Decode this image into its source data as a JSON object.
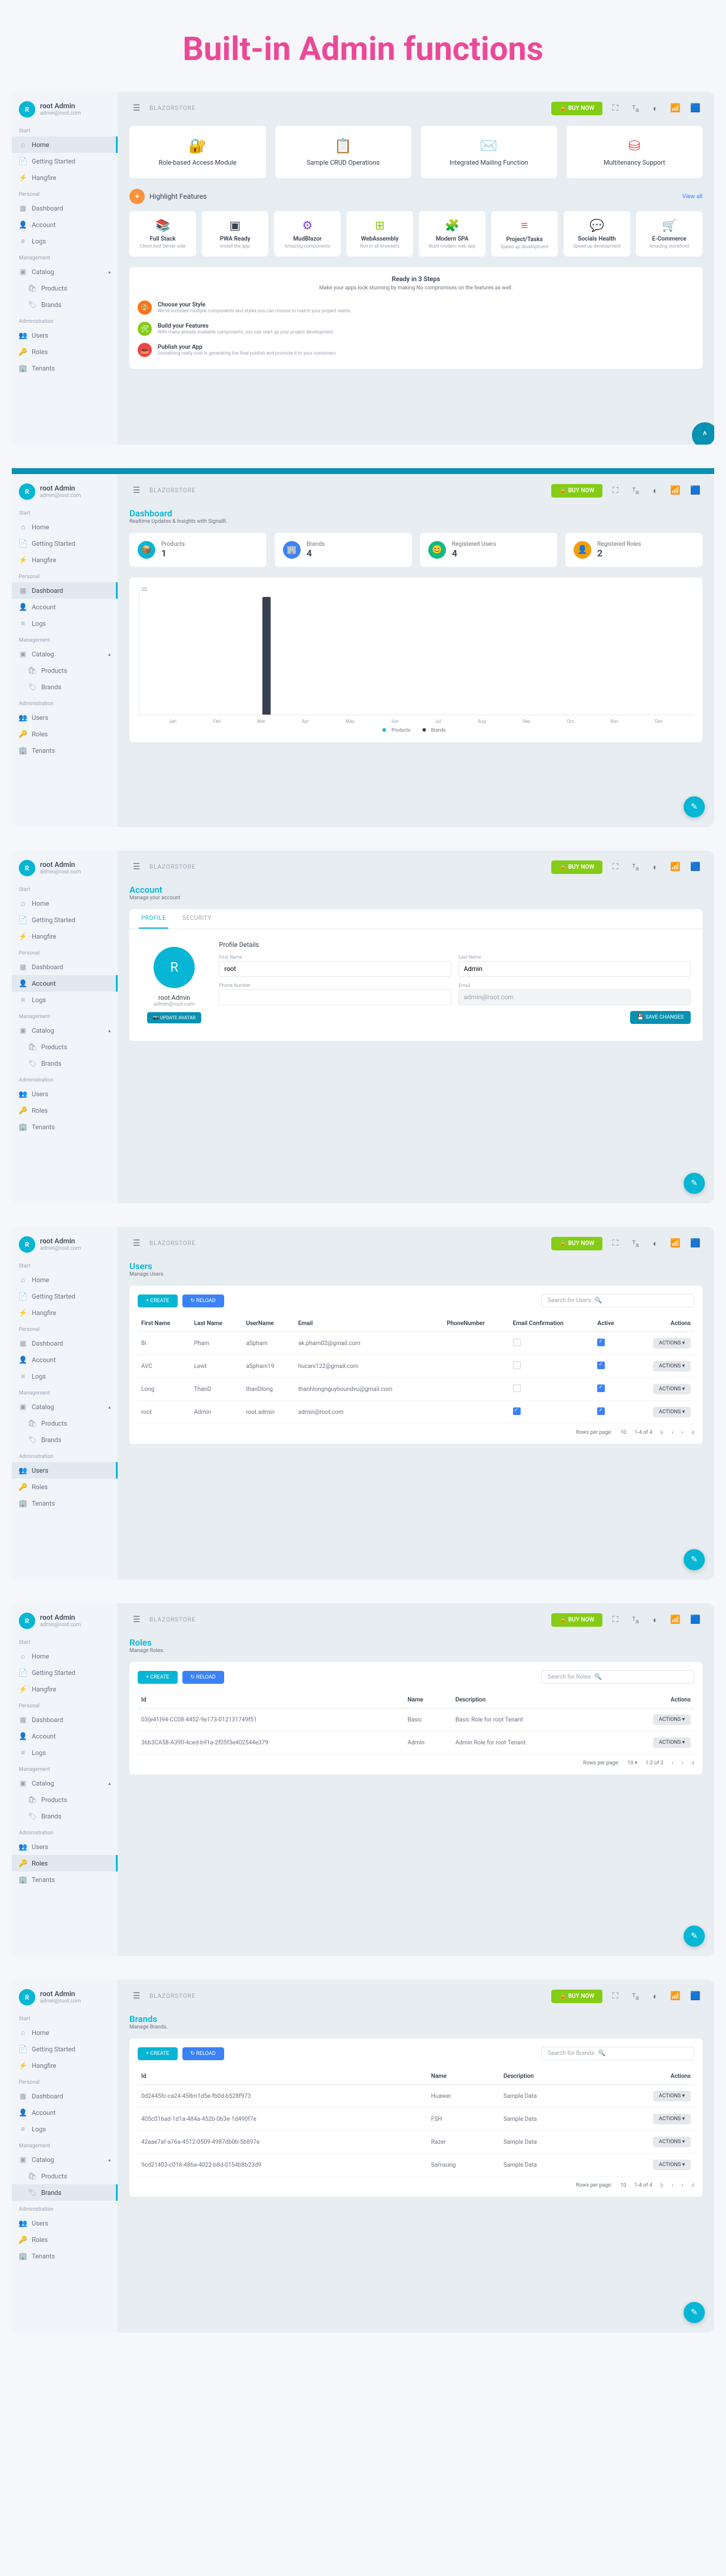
{
  "title": "Built-in Admin functions",
  "user": {
    "initial": "R",
    "name": "root Admin",
    "email": "admin@root.com"
  },
  "nav": {
    "s_start": "Start",
    "home": "Home",
    "getting": "Getting Started",
    "hangfire": "Hangfire",
    "s_personal": "Personal",
    "dashboard": "Dashboard",
    "account": "Account",
    "logs": "Logs",
    "s_mgmt": "Management",
    "catalog": "Catalog",
    "products": "Products",
    "brands": "Brands",
    "s_admin": "Administration",
    "users": "Users",
    "roles": "Roles",
    "tenants": "Tenants"
  },
  "topbar": {
    "brand": "BLAZORSTORE",
    "buy": "BUY NOW"
  },
  "s1": {
    "feats": [
      {
        "icon": "🔐",
        "lbl": "Role-based Access Module",
        "c": "#f97316"
      },
      {
        "icon": "📋",
        "lbl": "Sample CRUD Operations",
        "c": "#ef4444"
      },
      {
        "icon": "✉️",
        "lbl": "Integrated Mailing Function",
        "c": "#f97316"
      },
      {
        "icon": "⛁",
        "lbl": "Multitenancy Support",
        "c": "#ef4444"
      }
    ],
    "hl_title": "Highlight Features",
    "hl_view": "View all",
    "hl": [
      {
        "ico": "📚",
        "name": "Full Stack",
        "desc": "Client And Server side",
        "c": "#d97706"
      },
      {
        "ico": "▣",
        "name": "PWA Ready",
        "desc": "Install the app",
        "c": "#374151"
      },
      {
        "ico": "⚙",
        "name": "MudBlazor",
        "desc": "Amazing components",
        "c": "#7c3aed"
      },
      {
        "ico": "⊞",
        "name": "WebAssembly",
        "desc": "Run in all browsers",
        "c": "#84cc16"
      },
      {
        "ico": "🧩",
        "name": "Modern SPA",
        "desc": "Build modern web app",
        "c": "#06b6d4"
      },
      {
        "ico": "≡",
        "name": "Project/Tasks",
        "desc": "Speed up development",
        "c": "#ef4444"
      },
      {
        "ico": "💬",
        "name": "Socials Health",
        "desc": "Speed up development",
        "c": "#0891b2"
      },
      {
        "ico": "🛒",
        "name": "E-Commerce",
        "desc": "Amazing storefront",
        "c": "#f59e0b"
      }
    ],
    "steps_title": "Ready in 3 Steps",
    "steps_sub": "Make your apps look stunning by making No compromises on the features as well.",
    "steps": [
      {
        "c": "#f97316",
        "ico": "🎨",
        "t": "Choose your Style",
        "d": "We've included multiple components and styles you can choose to match your project needs."
      },
      {
        "c": "#84cc16",
        "ico": "🛠",
        "t": "Build your Features",
        "d": "With many already available components, you can start up your project development."
      },
      {
        "c": "#ef4444",
        "ico": "📤",
        "t": "Publish your App",
        "d": "Something really cool is generating the final publish and promote it to your customers."
      }
    ]
  },
  "s2": {
    "title": "Dashboard",
    "sub": "Realtime Updates & Insights with SignalR.",
    "stats": [
      {
        "c": "#06b6d4",
        "ico": "📦",
        "lbl": "Products",
        "val": "1"
      },
      {
        "c": "#3b82f6",
        "ico": "🏢",
        "lbl": "Brands",
        "val": "4"
      },
      {
        "c": "#10b981",
        "ico": "😊",
        "lbl": "Registered Users",
        "val": "4"
      },
      {
        "c": "#f59e0b",
        "ico": "👤",
        "lbl": "Registered Roles",
        "val": "2"
      }
    ],
    "months": [
      "Jan",
      "Feb",
      "Mar",
      "Apr",
      "May",
      "Jun",
      "Jul",
      "Aug",
      "Sep",
      "Oct",
      "Nov",
      "Dec"
    ],
    "legend": {
      "p": "Products",
      "b": "Brands"
    }
  },
  "chart_data": {
    "type": "bar",
    "categories": [
      "Jan",
      "Feb",
      "Mar",
      "Apr",
      "May",
      "Jun",
      "Jul",
      "Aug",
      "Sep",
      "Oct",
      "Nov",
      "Dec"
    ],
    "series": [
      {
        "name": "Products",
        "values": [
          0,
          0,
          0,
          0,
          0,
          0,
          0,
          0,
          0,
          0,
          0,
          0
        ]
      },
      {
        "name": "Brands",
        "values": [
          0,
          0,
          20,
          0,
          0,
          0,
          0,
          0,
          0,
          0,
          0,
          0
        ]
      }
    ],
    "ylim": [
      0,
      20
    ],
    "ylabel": "",
    "xlabel": "",
    "title": ""
  },
  "s3": {
    "title": "Account",
    "sub": "Manage your account",
    "tab_profile": "PROFILE",
    "tab_sec": "SECURITY",
    "name": "root Admin",
    "email": "admin@root.com",
    "btn_avatar": "UPDATE AVATAR",
    "hdr": "Profile Details",
    "f_fn": "First Name",
    "v_fn": "root",
    "f_ln": "Last Name",
    "v_ln": "Admin",
    "f_ph": "Phone Number",
    "f_em": "Email",
    "v_em": "admin@root.com",
    "btn_save": "SAVE CHANGES"
  },
  "s4": {
    "title": "Users",
    "sub": "Manage Users",
    "create": "+ CREATE",
    "reload": "↻ RELOAD",
    "search": "Search for Users",
    "cols": {
      "fn": "First Name",
      "ln": "Last Name",
      "un": "UserName",
      "em": "Email",
      "ph": "PhoneNumber",
      "ec": "Email Confirmation",
      "ac": "Active",
      "act": "Actions"
    },
    "rows": [
      {
        "fn": "Bi",
        "ln": "Pham",
        "un": "aSpham",
        "em": "ak.pham02@gmail.com",
        "ph": "",
        "ec": false,
        "ac": true
      },
      {
        "fn": "AVC",
        "ln": "Lewt",
        "un": "aSpham19",
        "em": "hucani122@gmail.com",
        "ph": "",
        "ec": false,
        "ac": true
      },
      {
        "fn": "Long",
        "ln": "ThanD",
        "un": "thanDlong",
        "em": "thanhlongnguyhoundvu@gmail.com",
        "ph": "",
        "ec": false,
        "ac": true
      },
      {
        "fn": "root",
        "ln": "Admin",
        "un": "root.admin",
        "em": "admin@root.com",
        "ph": "",
        "ec": true,
        "ac": true
      }
    ],
    "actions": "ACTIONS ▾",
    "pag": {
      "rpp": "Rows per page:",
      "pp": "10",
      "range": "1-4 of 4"
    }
  },
  "s5": {
    "title": "Roles",
    "sub": "Manage Roles.",
    "create": "+ CREATE",
    "reload": "↻ RELOAD",
    "search": "Search for Roles",
    "cols": {
      "id": "Id",
      "nm": "Name",
      "ds": "Description",
      "act": "Actions"
    },
    "rows": [
      {
        "id": "03{e41}94-CC08-4452-9e173-012131749f51",
        "nm": "Basic",
        "ds": "Basic Role for root Tenant"
      },
      {
        "id": "36b3CA58-A390-4ced-b91a-2f05f3e402544e379",
        "nm": "Admin",
        "ds": "Admin Role for root Tenant"
      }
    ],
    "actions": "ACTIONS ▾",
    "pag": {
      "rpp": "Rows per page:",
      "pp": "10 ▾",
      "range": "1-2 of 2"
    }
  },
  "s6": {
    "title": "Brands",
    "sub": "Manage Brands.",
    "create": "+ CREATE",
    "reload": "↻ RELOAD",
    "search": "Search for Brands",
    "cols": {
      "id": "Id",
      "nm": "Name",
      "ds": "Description",
      "act": "Actions"
    },
    "rows": [
      {
        "id": "0d2445fc-ca24-458m1d5e-fb0d-b528f973",
        "nm": "Huawei",
        "ds": "Sample Data"
      },
      {
        "id": "405c016ad-1d1a-484a-452b-0b3e-1d490f7e",
        "nm": "FSH",
        "ds": "Sample Data"
      },
      {
        "id": "42aae7af-a76a-4512-0509-4987db0b-5b897e",
        "nm": "Razer",
        "ds": "Sample Data"
      },
      {
        "id": "9cd21403-c018-486a-4022-b8d-0154b8b23d9",
        "nm": "Samsung",
        "ds": "Sample Data"
      }
    ],
    "actions": "ACTIONS ▾",
    "pag": {
      "rpp": "Rows per page:",
      "pp": "10",
      "range": "1-4 of 4"
    }
  }
}
